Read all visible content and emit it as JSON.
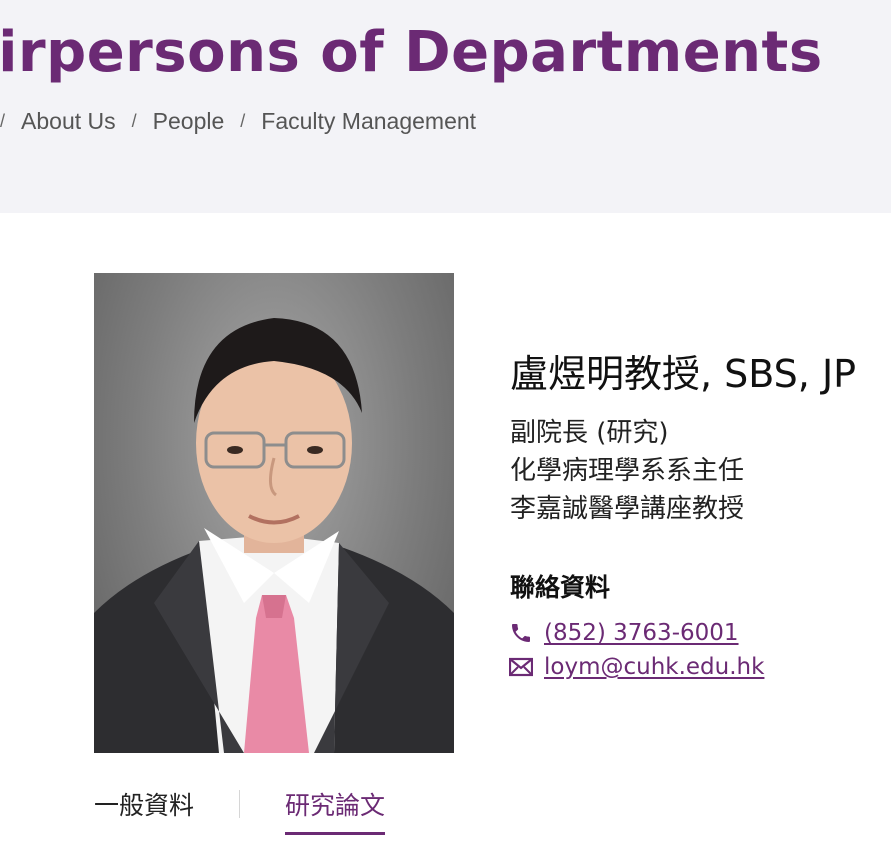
{
  "header": {
    "page_title": "airpersons of Departments",
    "breadcrumb": [
      {
        "label": "About Us"
      },
      {
        "label": "People"
      },
      {
        "label": "Faculty Management"
      }
    ]
  },
  "profile": {
    "name": "盧煜明教授, SBS, JP",
    "titles": [
      "副院長 (研究)",
      "化學病理學系系主任",
      "李嘉誠醫學講座教授"
    ],
    "contact_heading": "聯絡資料",
    "phone": "(852) 3763-6001",
    "email": "loym@cuhk.edu.hk"
  },
  "tabs": [
    {
      "label": "一般資料",
      "active": false
    },
    {
      "label": "研究論文",
      "active": true
    }
  ],
  "colors": {
    "accent": "#6b2a74",
    "hero_bg": "#f3f3f7"
  },
  "icons": {
    "phone": "phone-icon",
    "email": "envelope-icon"
  }
}
